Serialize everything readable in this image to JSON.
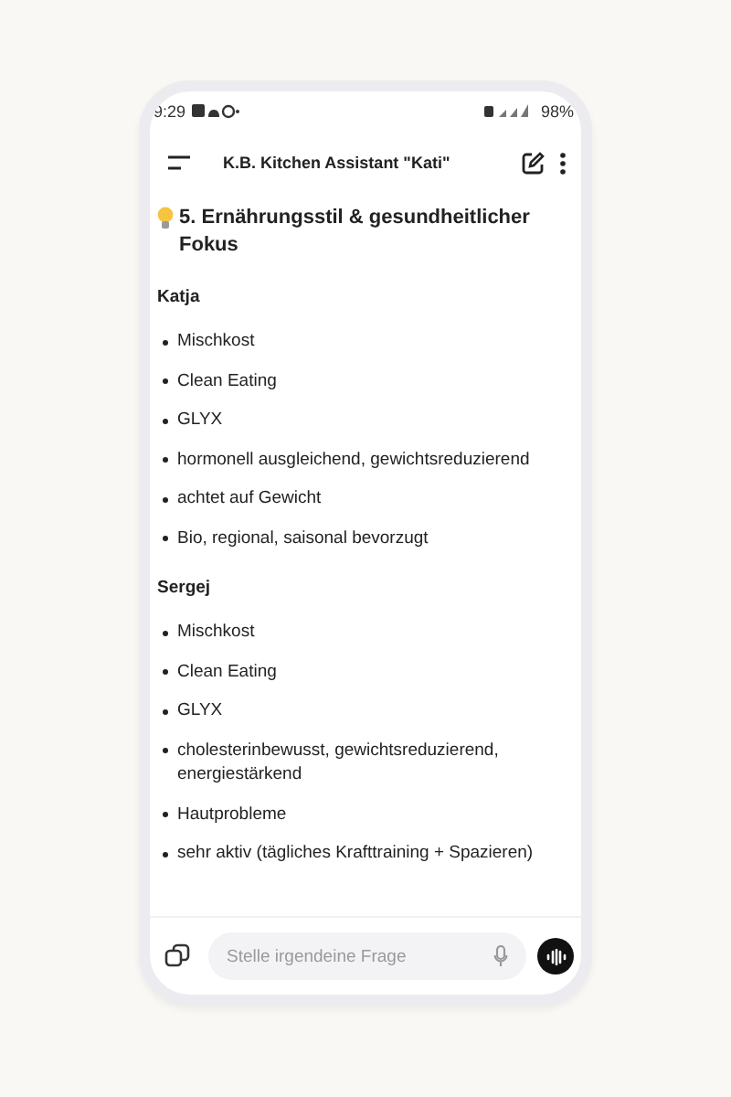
{
  "status_bar": {
    "time": "9:29",
    "battery": "98%"
  },
  "header": {
    "title": "K.B. Kitchen Assistant \"Kati\""
  },
  "heading": "5. Ernährungsstil & gesundheitlicher Fokus",
  "persons": [
    {
      "name": "Katja",
      "items": [
        "Mischkost",
        "Clean Eating",
        "GLYX",
        "hormonell ausgleichend, gewichtsreduzierend",
        "achtet auf Gewicht",
        "Bio, regional, saisonal bevorzugt"
      ]
    },
    {
      "name": "Sergej",
      "items": [
        "Mischkost",
        "Clean Eating",
        "GLYX",
        "cholesterinbewusst, gewichtsreduzierend, energiestärkend",
        "Hautprobleme",
        "sehr aktiv (tägliches Krafttraining + Spazieren)"
      ]
    }
  ],
  "input": {
    "placeholder": "Stelle irgendeine Frage"
  }
}
